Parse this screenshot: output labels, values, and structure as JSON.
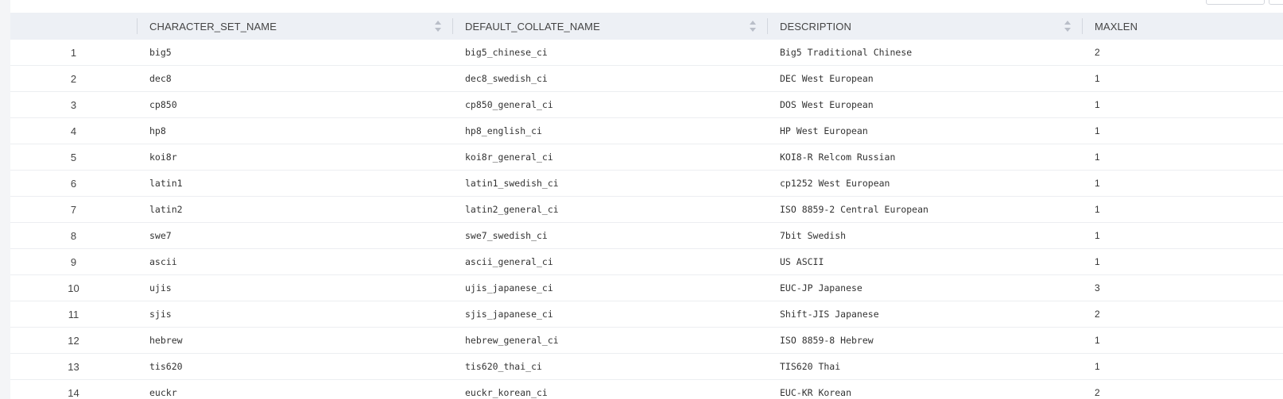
{
  "table": {
    "columns": [
      "",
      "CHARACTER_SET_NAME",
      "DEFAULT_COLLATE_NAME",
      "DESCRIPTION",
      "MAXLEN"
    ],
    "rows": [
      [
        "1",
        "big5",
        "big5_chinese_ci",
        "Big5 Traditional Chinese",
        "2"
      ],
      [
        "2",
        "dec8",
        "dec8_swedish_ci",
        "DEC West European",
        "1"
      ],
      [
        "3",
        "cp850",
        "cp850_general_ci",
        "DOS West European",
        "1"
      ],
      [
        "4",
        "hp8",
        "hp8_english_ci",
        "HP West European",
        "1"
      ],
      [
        "5",
        "koi8r",
        "koi8r_general_ci",
        "KOI8-R Relcom Russian",
        "1"
      ],
      [
        "6",
        "latin1",
        "latin1_swedish_ci",
        "cp1252 West European",
        "1"
      ],
      [
        "7",
        "latin2",
        "latin2_general_ci",
        "ISO 8859-2 Central European",
        "1"
      ],
      [
        "8",
        "swe7",
        "swe7_swedish_ci",
        "7bit Swedish",
        "1"
      ],
      [
        "9",
        "ascii",
        "ascii_general_ci",
        "US ASCII",
        "1"
      ],
      [
        "10",
        "ujis",
        "ujis_japanese_ci",
        "EUC-JP Japanese",
        "3"
      ],
      [
        "11",
        "sjis",
        "sjis_japanese_ci",
        "Shift-JIS Japanese",
        "2"
      ],
      [
        "12",
        "hebrew",
        "hebrew_general_ci",
        "ISO 8859-8 Hebrew",
        "1"
      ],
      [
        "13",
        "tis620",
        "tis620_thai_ci",
        "TIS620 Thai",
        "1"
      ],
      [
        "14",
        "euckr",
        "euckr_korean_ci",
        "EUC-KR Korean",
        "2"
      ]
    ]
  },
  "icons": {
    "sort": "sort-icon"
  },
  "colors": {
    "header_bg": "#edf0f5",
    "row_border": "#eceef1"
  }
}
